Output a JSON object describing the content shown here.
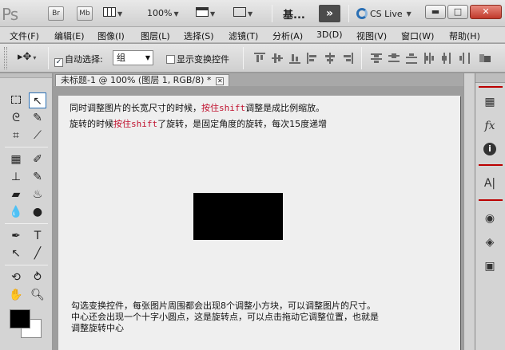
{
  "app": {
    "logo": "Ps",
    "bridge_btn": "Br",
    "minibridge_btn": "Mb",
    "zoom_value": "100%",
    "workspace_label": "基...",
    "workspace_more": "»",
    "cslive_label": "CS Live",
    "window_buttons": {
      "minimize": "▬",
      "maximize": "□",
      "close": "✕"
    }
  },
  "menubar": {
    "items": [
      "文件(F)",
      "编辑(E)",
      "图像(I)",
      "图层(L)",
      "选择(S)",
      "滤镜(T)",
      "分析(A)",
      "3D(D)",
      "视图(V)",
      "窗口(W)",
      "帮助(H)"
    ]
  },
  "options_bar": {
    "tool_preset_icon": "move-tool-icon",
    "auto_select_label": "自动选择:",
    "auto_select_checked": true,
    "auto_select_value": "组",
    "show_transform_label": "显示变换控件",
    "show_transform_checked": false
  },
  "document": {
    "tab_title": "未标题-1 @ 100% (图层 1, RGB/8) *",
    "tab_close": "✕"
  },
  "canvas_notes": {
    "line1_a": "同时调整图片的长宽尺寸的时候，",
    "line1_b": "按住shift",
    "line1_c": "调整是成比例缩放。",
    "line2_a": "旋转的时候",
    "line2_b": "按住shift",
    "line2_c": "了旋转，是固定角度的旋转，每次15度递增",
    "bottom1": "勾选变换控件，每张图片周围都会出现8个调整小方块，可以调整图片的尺寸。",
    "bottom2": "中心还会出现一个十字小圆点，这是旋转点，可以点击拖动它调整位置，也就是",
    "bottom3": "调整旋转中心"
  },
  "colors": {
    "accent_red": "#c0122f",
    "foreground_color": "#000000",
    "background_color": "#ffffff"
  },
  "tools": [
    "rect-marquee",
    "move",
    "lasso",
    "quick-select",
    "crop",
    "eyedropper",
    "spot-healing",
    "brush",
    "clone-stamp",
    "history-brush",
    "eraser",
    "paint-bucket",
    "blur",
    "dodge",
    "pen",
    "type",
    "path-select",
    "line",
    "3d-rotate",
    "3d-orbit",
    "hand",
    "zoom"
  ],
  "dock_icons": [
    "histogram-icon",
    "fx-icon",
    "info-icon",
    "character-icon",
    "channels-icon",
    "layers-icon",
    "paths-icon"
  ]
}
